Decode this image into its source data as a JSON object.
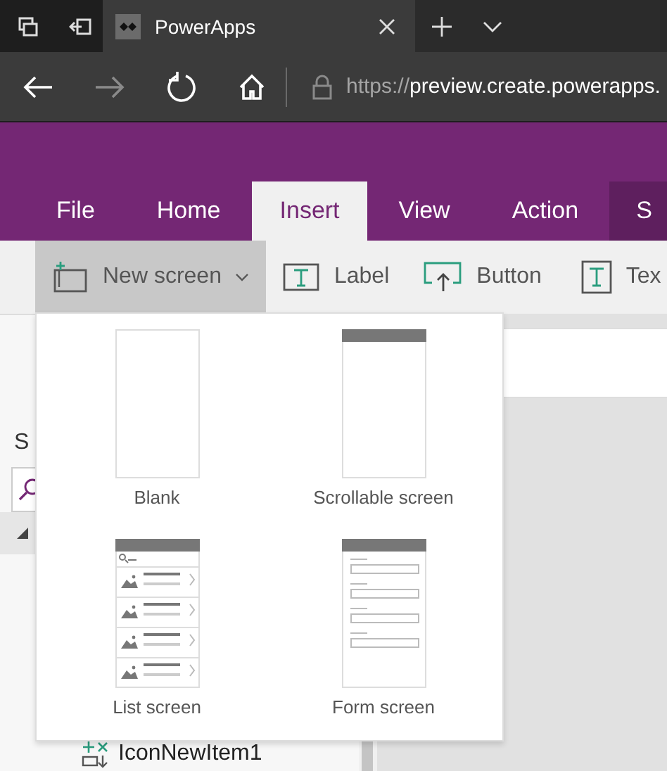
{
  "browser": {
    "tab": {
      "title": "PowerApps"
    },
    "address": {
      "scheme": "https://",
      "host": "preview.create.powerapps."
    }
  },
  "ribbon_tabs": [
    {
      "label": "File",
      "selected": false
    },
    {
      "label": "Home",
      "selected": false
    },
    {
      "label": "Insert",
      "selected": true
    },
    {
      "label": "View",
      "selected": false
    },
    {
      "label": "Action",
      "selected": false
    },
    {
      "label": "S",
      "selected": false
    }
  ],
  "toolbar": [
    {
      "label": "New screen",
      "kind": "new-screen",
      "selected": true
    },
    {
      "label": "Label",
      "kind": "label",
      "selected": false
    },
    {
      "label": "Button",
      "kind": "button",
      "selected": false
    },
    {
      "label": "Tex",
      "kind": "text-input",
      "selected": false
    }
  ],
  "left_panel": {
    "title": "S",
    "tree_item": "IconNewItem1"
  },
  "new_screen_menu": [
    {
      "label": "Blank",
      "kind": "blank"
    },
    {
      "label": "Scrollable screen",
      "kind": "scrollable"
    },
    {
      "label": "List screen",
      "kind": "list"
    },
    {
      "label": "Form screen",
      "kind": "form"
    }
  ]
}
